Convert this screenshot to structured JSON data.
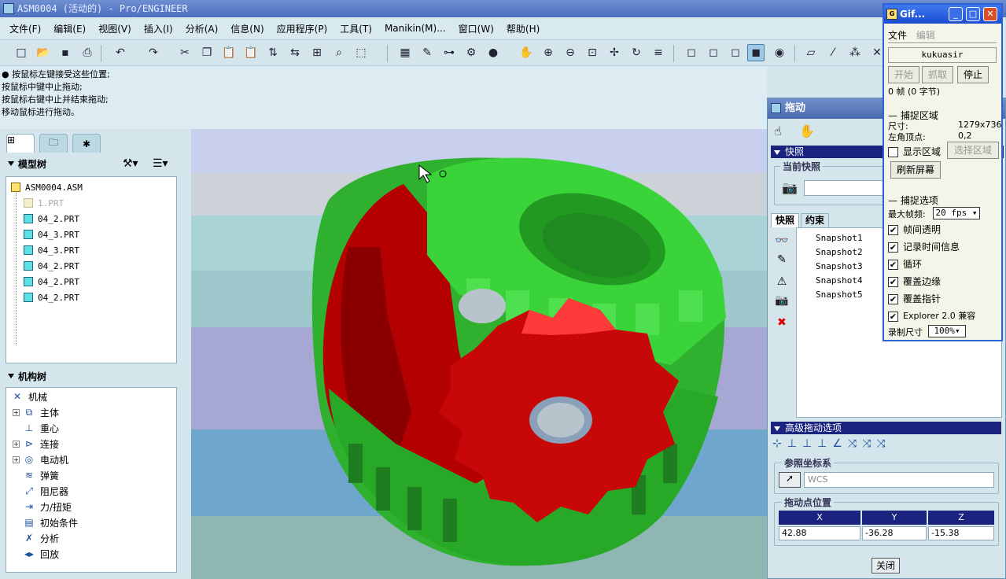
{
  "window": {
    "title": "ASM0004 (活动的) - Pro/ENGINEER"
  },
  "menu": [
    "文件(F)",
    "编辑(E)",
    "视图(V)",
    "插入(I)",
    "分析(A)",
    "信息(N)",
    "应用程序(P)",
    "工具(T)",
    "Manikin(M)...",
    "窗口(W)",
    "帮助(H)"
  ],
  "messages": [
    "● 按鼠标左键接受这些位置;",
    "按鼠标中键中止拖动;",
    "按鼠标右键中止并结束拖动;",
    "移动鼠标进行拖动。"
  ],
  "model_tree": {
    "title": "模型树",
    "items": [
      {
        "label": "ASM0004.ASM",
        "type": "asm"
      },
      {
        "label": "1.PRT",
        "type": "dim"
      },
      {
        "label": "04_2.PRT",
        "type": "prt"
      },
      {
        "label": "04_3.PRT",
        "type": "prt"
      },
      {
        "label": "04_3.PRT",
        "type": "prt"
      },
      {
        "label": "04_2.PRT",
        "type": "prt"
      },
      {
        "label": "04_2.PRT",
        "type": "prt"
      },
      {
        "label": "04_2.PRT",
        "type": "prt"
      }
    ]
  },
  "mech_tree": {
    "title": "机构树",
    "items": [
      "机械",
      "主体",
      "重心",
      "连接",
      "电动机",
      "弹簧",
      "阻尼器",
      "力/扭矩",
      "初始条件",
      "分析",
      "回放"
    ]
  },
  "drag_dialog": {
    "title": "拖动",
    "snapshot_section": "快照",
    "current_snapshot_label": "当前快照",
    "tabs": [
      "快照",
      "约束"
    ],
    "snapshots": [
      "Snapshot1",
      "Snapshot2",
      "Snapshot3",
      "Snapshot4",
      "Snapshot5"
    ],
    "advanced_section": "高级拖动选项",
    "ref_coord_label": "参照坐标系",
    "ref_coord_value": "WCS",
    "drag_point_label": "拖动点位置",
    "coord_headers": [
      "X",
      "Y",
      "Z"
    ],
    "coord_values": [
      "42.88",
      "-36.28",
      "-15.38"
    ],
    "close_label": "关闭"
  },
  "gif_window": {
    "title": "Gif...",
    "menu": [
      "文件",
      "编辑"
    ],
    "user": "kukuasir",
    "buttons": {
      "start": "开始",
      "capture": "抓取",
      "stop": "停止"
    },
    "frames_text": "0 帧 (0 字节)",
    "capture_area_label": "捕捉区域",
    "size_label": "尺寸:",
    "size_value": "1279x736",
    "topleft_label": "左角顶点:",
    "topleft_value": "0,2",
    "show_area_label": "显示区域",
    "select_area_label": "选择区域",
    "refresh_label": "刷新屏幕",
    "capture_options_label": "捕捉选项",
    "max_fps_label": "最大帧频:",
    "max_fps_value": "20 fps",
    "options": [
      "帧间透明",
      "记录时间信息",
      "循环",
      "覆盖边缘",
      "覆盖指针",
      "Explorer 2.0 兼容"
    ],
    "rec_size_label": "录制尺寸",
    "rec_size_value": "100%"
  },
  "colors": {
    "gear_red": "#c00000",
    "gear_green": "#2fc02f",
    "dialog_header": "#1a237e"
  }
}
